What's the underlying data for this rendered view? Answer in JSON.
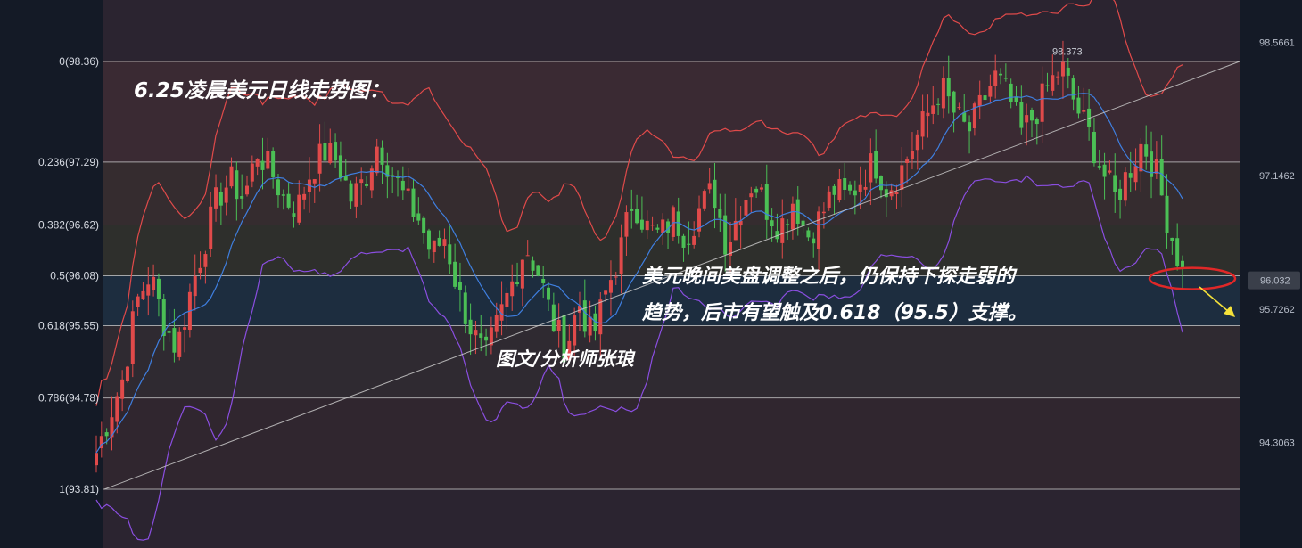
{
  "chart_data": {
    "type": "candlestick",
    "title": "6.25凌晨美元日线走势图：",
    "annotation_lines": [
      "美元晚间美盘调整之后，仍保持下探走弱的",
      "趋势，后市有望触及0.618（95.5）支撑。"
    ],
    "author": "图文/分析师张琅",
    "fib_levels": [
      {
        "label": "0(98.36)",
        "ratio": 0,
        "value": 98.36
      },
      {
        "label": "0.236(97.29)",
        "ratio": 0.236,
        "value": 97.29
      },
      {
        "label": "0.382(96.62)",
        "ratio": 0.382,
        "value": 96.62
      },
      {
        "label": "0.5(96.08)",
        "ratio": 0.5,
        "value": 96.08
      },
      {
        "label": "0.618(95.55)",
        "ratio": 0.618,
        "value": 95.55
      },
      {
        "label": "0.786(94.78)",
        "ratio": 0.786,
        "value": 94.78
      },
      {
        "label": "1(93.81)",
        "ratio": 1,
        "value": 93.81
      }
    ],
    "price_axis_ticks": [
      "98.5661",
      "97.1462",
      "95.7262",
      "94.3063"
    ],
    "price_axis_values": [
      98.5661,
      97.1462,
      95.7262,
      94.3063
    ],
    "current_price": "96.032",
    "current_value": 96.032,
    "peak_label": "98.373",
    "peak_value": 98.373,
    "trendline": {
      "from_value": 93.81,
      "to_value": 98.36
    },
    "ylim": [
      93.2,
      98.9
    ],
    "close_path": [
      94.2,
      94.6,
      95.0,
      95.8,
      96.1,
      95.6,
      95.3,
      95.9,
      96.4,
      96.9,
      97.1,
      96.9,
      97.4,
      97.2,
      96.9,
      96.8,
      97.2,
      97.4,
      97.3,
      96.9,
      97.1,
      97.5,
      97.2,
      96.9,
      96.7,
      96.3,
      96.5,
      95.9,
      95.5,
      95.2,
      95.6,
      96.0,
      96.4,
      96.1,
      95.6,
      95.3,
      95.8,
      95.4,
      95.9,
      96.3,
      96.9,
      96.6,
      96.5,
      96.7,
      96.5,
      96.8,
      97.0,
      96.4,
      96.8,
      97.1,
      96.8,
      96.6,
      96.9,
      96.5,
      96.7,
      97.0,
      96.9,
      97.1,
      97.3,
      97.0,
      97.2,
      97.5,
      97.8,
      98.1,
      97.8,
      97.6,
      97.9,
      98.2,
      98.0,
      97.6,
      97.8,
      98.1,
      98.3,
      97.9,
      97.6,
      97.2,
      96.9,
      97.2,
      97.5,
      97.2,
      96.6,
      96.1
    ],
    "series": [
      {
        "name": "",
        "color": "#e04a4a"
      },
      {
        "name": "",
        "color": "#3f7fe0"
      },
      {
        "name": "",
        "color": "#8a4ee0"
      }
    ],
    "colors": {
      "up": "#e04a4a",
      "down": "#4bbf55",
      "trendline": "#c8c8c8",
      "fib_line": "#cfcfcf",
      "highlight_ellipse": "#e02828",
      "arrow": "#f5e23a"
    }
  }
}
